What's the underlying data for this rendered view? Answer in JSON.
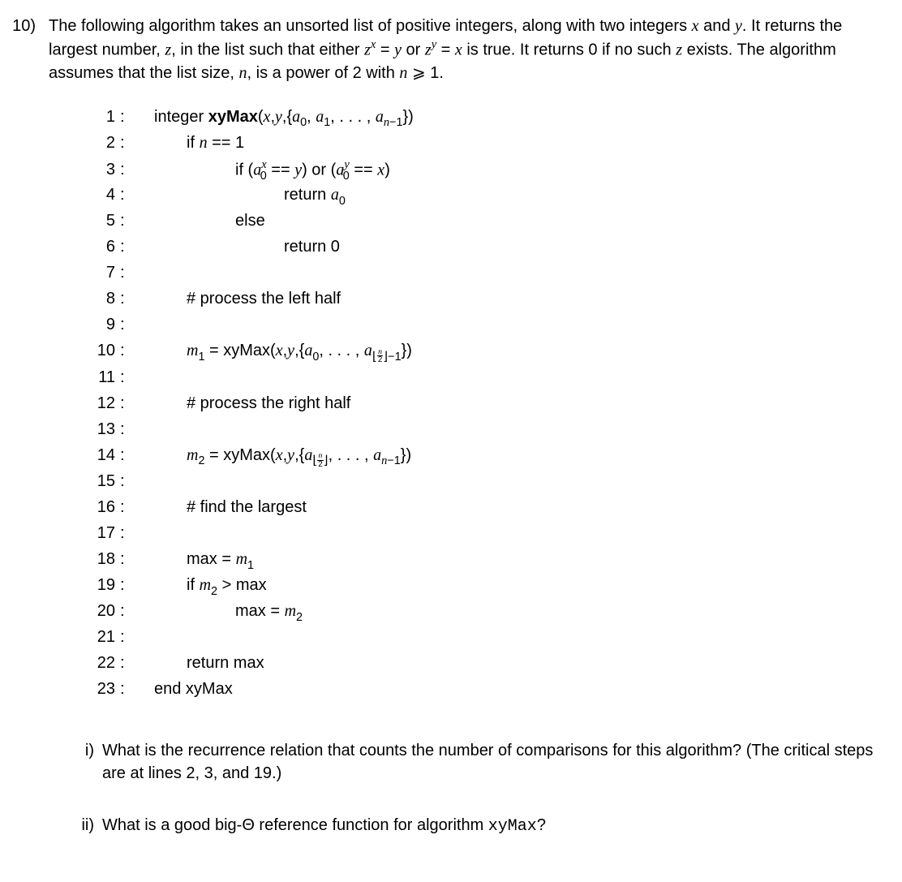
{
  "problem_number": "10)",
  "intro_parts": {
    "t1": "The following algorithm takes an unsorted list of positive integers, along with two integers ",
    "x": "x",
    "t2": " and ",
    "y": "y",
    "t3": ".  It returns the largest number, ",
    "z": "z",
    "t4": ", in the list such that either ",
    "zx": "z",
    "zxsup": "x",
    "eq1": " = ",
    "yv": "y",
    "or": " or ",
    "zy": "z",
    "zysup": "y",
    "eq2": " = ",
    "xv": "x",
    "t5": " is true. It returns 0 if no such ",
    "zv2": "z",
    "t6": " exists. The algorithm assumes that the list size, ",
    "n": "n",
    "t7": ", is a power of 2 with ",
    "nv": "n",
    "ge": " ⩾ 1."
  },
  "lines": {
    "l1n": "1",
    "l2n": "2",
    "l3n": "3",
    "l4n": "4",
    "l5n": "5",
    "l6n": "6",
    "l7n": "7",
    "l8n": "8",
    "l9n": "9",
    "l10n": "10",
    "l11n": "11",
    "l12n": "12",
    "l13n": "13",
    "l14n": "14",
    "l15n": "15",
    "l16n": "16",
    "l17n": "17",
    "l18n": "18",
    "l19n": "19",
    "l20n": "20",
    "l21n": "21",
    "l22n": "22",
    "l23n": "23"
  },
  "c": {
    "l1_a": "integer ",
    "l1_b": "xyMax",
    "l1_c": "(",
    "l1_x": "x",
    "l1_cm1": ",",
    "l1_y": "y",
    "l1_cm2": ",{",
    "l1_a0": "a",
    "l1_s0": "0",
    "l1_cm3": ", ",
    "l1_a1": "a",
    "l1_s1": "1",
    "l1_cm4": ", . . . , ",
    "l1_an": "a",
    "l1_sn1": "n",
    "l1_sn2": "−1",
    "l1_end": "})",
    "l2_a": "if ",
    "l2_n": "n",
    "l2_b": " == 1",
    "l3_a": "if (",
    "l3_a0a": "a",
    "l3_supx": "x",
    "l3_sub0a": "0",
    "l3_b": " == ",
    "l3_y": "y",
    "l3_c": ") or (",
    "l3_a0b": "a",
    "l3_supy": "y",
    "l3_sub0b": "0",
    "l3_d": " == ",
    "l3_x": "x",
    "l3_e": ")",
    "l4_a": "return ",
    "l4_a0": "a",
    "l4_s0": "0",
    "l5": "else",
    "l6": "return 0",
    "l8": "# process the left half",
    "l10_a": "m",
    "l10_s1": "1",
    "l10_b": " = xyMax(",
    "l10_x": "x",
    "l10_c": ",",
    "l10_y": "y",
    "l10_d": ",{",
    "l10_a0": "a",
    "l10_s0": "0",
    "l10_e": ", . . . , ",
    "l10_an": "a",
    "l10_fn": "n",
    "l10_fd": "2",
    "l10_m1": "−1",
    "l10_end": "})",
    "l12": "# process the right half",
    "l14_a": "m",
    "l14_s2": "2",
    "l14_b": " = xyMax(",
    "l14_x": "x",
    "l14_c": ",",
    "l14_y": "y",
    "l14_d": ",{",
    "l14_an1": "a",
    "l14_fn": "n",
    "l14_fd": "2",
    "l14_e": ", . . . , ",
    "l14_an2": "a",
    "l14_sn1": "n",
    "l14_sn2": "−1",
    "l14_end": "})",
    "l16": "# find the largest",
    "l18_a": "max = ",
    "l18_m": "m",
    "l18_s1": "1",
    "l19_a": "if ",
    "l19_m": "m",
    "l19_s2": "2",
    "l19_b": " > max",
    "l20_a": "max = ",
    "l20_m": "m",
    "l20_s2": "2",
    "l22": "return max",
    "l23": "end xyMax"
  },
  "parts": {
    "i_label": "i)",
    "i_text": "What is the recurrence relation that counts the number of comparisons for this algorithm? (The critical steps are at lines 2, 3, and 19.)",
    "ii_label": "ii)",
    "ii_t1": "What is a good big-Θ reference function for algorithm ",
    "ii_fn": "xyMax",
    "ii_t2": "?"
  }
}
